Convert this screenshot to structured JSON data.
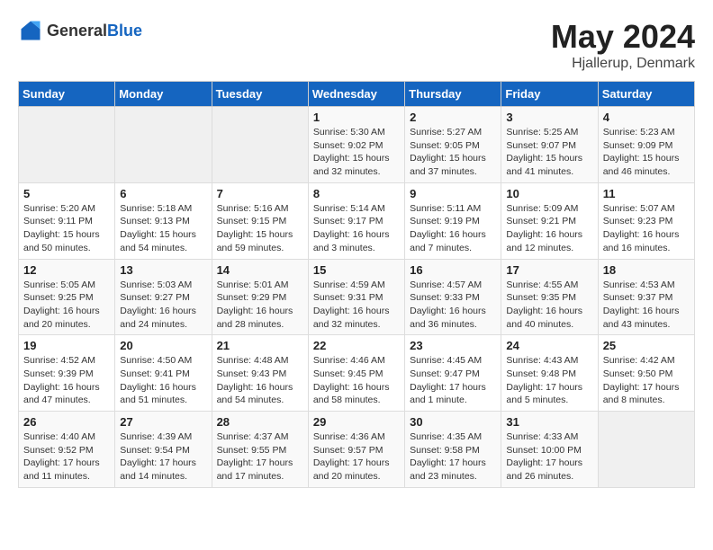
{
  "header": {
    "logo_general": "General",
    "logo_blue": "Blue",
    "title": "May 2024",
    "subtitle": "Hjallerup, Denmark"
  },
  "days_of_week": [
    "Sunday",
    "Monday",
    "Tuesday",
    "Wednesday",
    "Thursday",
    "Friday",
    "Saturday"
  ],
  "weeks": [
    [
      {
        "day": "",
        "content": ""
      },
      {
        "day": "",
        "content": ""
      },
      {
        "day": "",
        "content": ""
      },
      {
        "day": "1",
        "content": "Sunrise: 5:30 AM\nSunset: 9:02 PM\nDaylight: 15 hours and 32 minutes."
      },
      {
        "day": "2",
        "content": "Sunrise: 5:27 AM\nSunset: 9:05 PM\nDaylight: 15 hours and 37 minutes."
      },
      {
        "day": "3",
        "content": "Sunrise: 5:25 AM\nSunset: 9:07 PM\nDaylight: 15 hours and 41 minutes."
      },
      {
        "day": "4",
        "content": "Sunrise: 5:23 AM\nSunset: 9:09 PM\nDaylight: 15 hours and 46 minutes."
      }
    ],
    [
      {
        "day": "5",
        "content": "Sunrise: 5:20 AM\nSunset: 9:11 PM\nDaylight: 15 hours and 50 minutes."
      },
      {
        "day": "6",
        "content": "Sunrise: 5:18 AM\nSunset: 9:13 PM\nDaylight: 15 hours and 54 minutes."
      },
      {
        "day": "7",
        "content": "Sunrise: 5:16 AM\nSunset: 9:15 PM\nDaylight: 15 hours and 59 minutes."
      },
      {
        "day": "8",
        "content": "Sunrise: 5:14 AM\nSunset: 9:17 PM\nDaylight: 16 hours and 3 minutes."
      },
      {
        "day": "9",
        "content": "Sunrise: 5:11 AM\nSunset: 9:19 PM\nDaylight: 16 hours and 7 minutes."
      },
      {
        "day": "10",
        "content": "Sunrise: 5:09 AM\nSunset: 9:21 PM\nDaylight: 16 hours and 12 minutes."
      },
      {
        "day": "11",
        "content": "Sunrise: 5:07 AM\nSunset: 9:23 PM\nDaylight: 16 hours and 16 minutes."
      }
    ],
    [
      {
        "day": "12",
        "content": "Sunrise: 5:05 AM\nSunset: 9:25 PM\nDaylight: 16 hours and 20 minutes."
      },
      {
        "day": "13",
        "content": "Sunrise: 5:03 AM\nSunset: 9:27 PM\nDaylight: 16 hours and 24 minutes."
      },
      {
        "day": "14",
        "content": "Sunrise: 5:01 AM\nSunset: 9:29 PM\nDaylight: 16 hours and 28 minutes."
      },
      {
        "day": "15",
        "content": "Sunrise: 4:59 AM\nSunset: 9:31 PM\nDaylight: 16 hours and 32 minutes."
      },
      {
        "day": "16",
        "content": "Sunrise: 4:57 AM\nSunset: 9:33 PM\nDaylight: 16 hours and 36 minutes."
      },
      {
        "day": "17",
        "content": "Sunrise: 4:55 AM\nSunset: 9:35 PM\nDaylight: 16 hours and 40 minutes."
      },
      {
        "day": "18",
        "content": "Sunrise: 4:53 AM\nSunset: 9:37 PM\nDaylight: 16 hours and 43 minutes."
      }
    ],
    [
      {
        "day": "19",
        "content": "Sunrise: 4:52 AM\nSunset: 9:39 PM\nDaylight: 16 hours and 47 minutes."
      },
      {
        "day": "20",
        "content": "Sunrise: 4:50 AM\nSunset: 9:41 PM\nDaylight: 16 hours and 51 minutes."
      },
      {
        "day": "21",
        "content": "Sunrise: 4:48 AM\nSunset: 9:43 PM\nDaylight: 16 hours and 54 minutes."
      },
      {
        "day": "22",
        "content": "Sunrise: 4:46 AM\nSunset: 9:45 PM\nDaylight: 16 hours and 58 minutes."
      },
      {
        "day": "23",
        "content": "Sunrise: 4:45 AM\nSunset: 9:47 PM\nDaylight: 17 hours and 1 minute."
      },
      {
        "day": "24",
        "content": "Sunrise: 4:43 AM\nSunset: 9:48 PM\nDaylight: 17 hours and 5 minutes."
      },
      {
        "day": "25",
        "content": "Sunrise: 4:42 AM\nSunset: 9:50 PM\nDaylight: 17 hours and 8 minutes."
      }
    ],
    [
      {
        "day": "26",
        "content": "Sunrise: 4:40 AM\nSunset: 9:52 PM\nDaylight: 17 hours and 11 minutes."
      },
      {
        "day": "27",
        "content": "Sunrise: 4:39 AM\nSunset: 9:54 PM\nDaylight: 17 hours and 14 minutes."
      },
      {
        "day": "28",
        "content": "Sunrise: 4:37 AM\nSunset: 9:55 PM\nDaylight: 17 hours and 17 minutes."
      },
      {
        "day": "29",
        "content": "Sunrise: 4:36 AM\nSunset: 9:57 PM\nDaylight: 17 hours and 20 minutes."
      },
      {
        "day": "30",
        "content": "Sunrise: 4:35 AM\nSunset: 9:58 PM\nDaylight: 17 hours and 23 minutes."
      },
      {
        "day": "31",
        "content": "Sunrise: 4:33 AM\nSunset: 10:00 PM\nDaylight: 17 hours and 26 minutes."
      },
      {
        "day": "",
        "content": ""
      }
    ]
  ]
}
